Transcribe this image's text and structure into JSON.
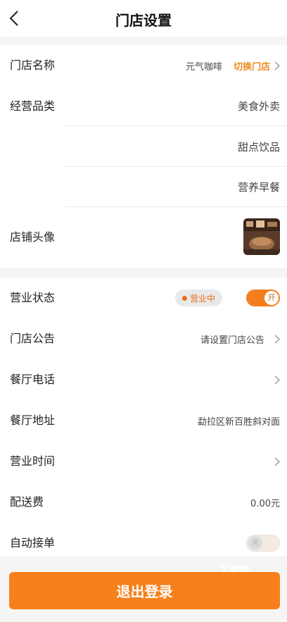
{
  "header": {
    "title": "门店设置"
  },
  "store_name": {
    "label": "门店名称",
    "value": "元气咖啡",
    "action": "切换门店"
  },
  "categories": {
    "label": "经营品类",
    "items": [
      "美食外卖",
      "甜点饮品",
      "营养早餐"
    ]
  },
  "avatar": {
    "label": "店铺头像",
    "icon": "shop-photo"
  },
  "business_status": {
    "label": "营业状态",
    "badge": "营业中",
    "toggle_label": "开",
    "on": true
  },
  "notice": {
    "label": "门店公告",
    "placeholder": "请设置门店公告"
  },
  "phone": {
    "label": "餐厅电话",
    "value": ""
  },
  "address": {
    "label": "餐厅地址",
    "value": "勐拉区新百胜斜对面"
  },
  "hours": {
    "label": "营业时间",
    "value": ""
  },
  "delivery_fee": {
    "label": "配送费",
    "value": "0.00元"
  },
  "auto_accept": {
    "label": "自动接单",
    "toggle_label": "关",
    "on": false
  },
  "logout": {
    "label": "退出登录"
  },
  "overlay": {
    "text": "下载是"
  },
  "colors": {
    "accent": "#f7801c",
    "background": "#f5f5f5"
  }
}
